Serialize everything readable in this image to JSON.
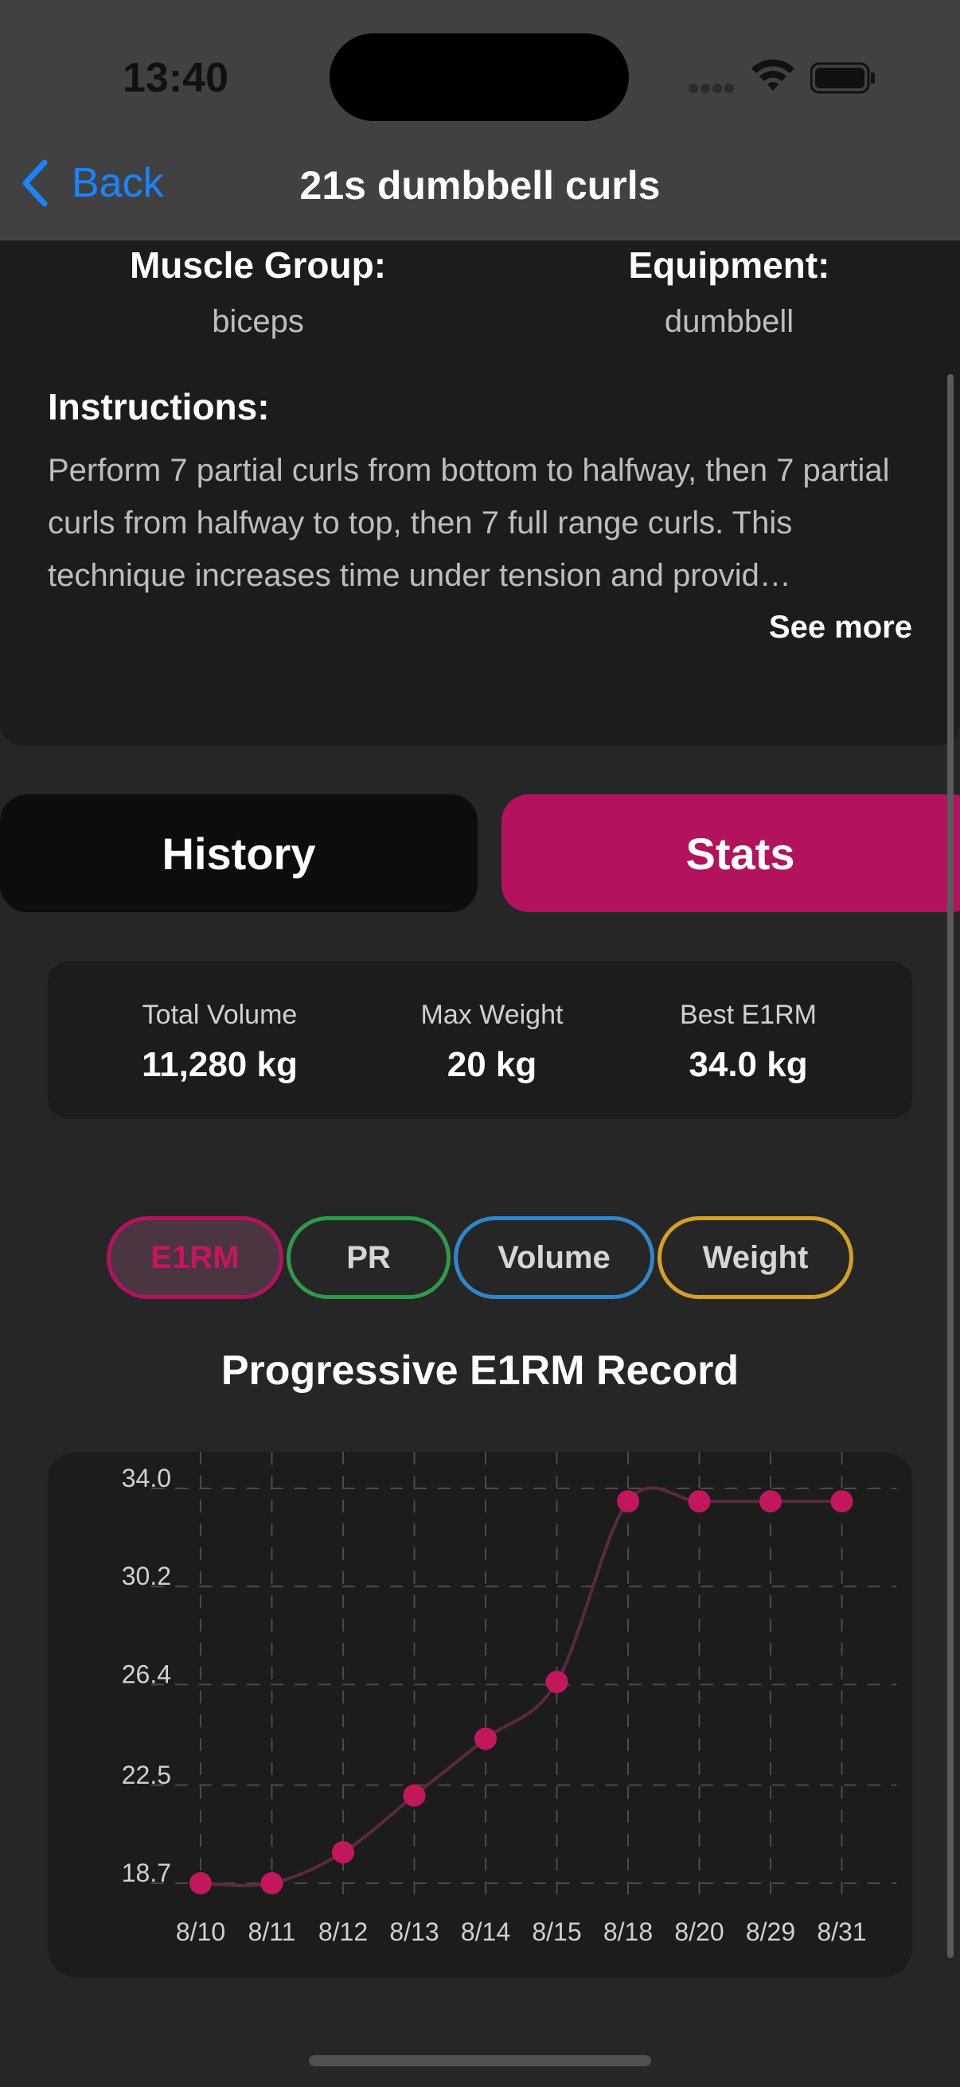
{
  "status_bar": {
    "time": "13:40"
  },
  "nav": {
    "back_label": "Back",
    "title": "21s dumbbell curls"
  },
  "info": {
    "muscle_group_label": "Muscle Group:",
    "muscle_group_value": "biceps",
    "equipment_label": "Equipment:",
    "equipment_value": "dumbbell",
    "instructions_label": "Instructions:",
    "instructions_text": "Perform 7 partial curls from bottom to halfway, then 7 partial curls from halfway to top, then 7 full range curls. This technique increases time under tension and provid…",
    "see_more_label": "See more"
  },
  "tabs": [
    {
      "label": "History",
      "active": false
    },
    {
      "label": "Stats",
      "active": true
    }
  ],
  "summary": [
    {
      "label": "Total Volume",
      "value": "11,280 kg"
    },
    {
      "label": "Max Weight",
      "value": "20 kg"
    },
    {
      "label": "Best E1RM",
      "value": "34.0 kg"
    }
  ],
  "metric_pills": [
    {
      "label": "E1RM",
      "color": "#b3135c",
      "selected": true
    },
    {
      "label": "PR",
      "color": "#2f9a4a",
      "selected": false
    },
    {
      "label": "Volume",
      "color": "#2f86c9",
      "selected": false
    },
    {
      "label": "Weight",
      "color": "#d4a126",
      "selected": false
    }
  ],
  "chart_data": {
    "type": "line",
    "title": "Progressive E1RM Record",
    "color": "#c2185b",
    "categories": [
      "8/10",
      "8/11",
      "8/12",
      "8/13",
      "8/14",
      "8/15",
      "8/18",
      "8/20",
      "8/29",
      "8/31"
    ],
    "values": [
      18.7,
      18.7,
      19.9,
      22.1,
      24.3,
      26.5,
      33.5,
      33.5,
      33.5,
      33.5
    ],
    "y_ticks": [
      "34.0",
      "30.2",
      "26.4",
      "22.5",
      "18.7"
    ],
    "ylim": [
      18.7,
      34.0
    ],
    "grid": true,
    "xlabel": "",
    "ylabel": ""
  }
}
